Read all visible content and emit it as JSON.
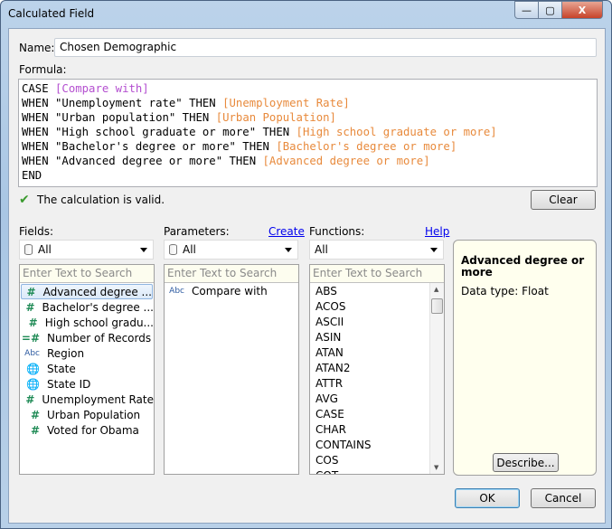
{
  "window": {
    "title": "Calculated Field",
    "minimize": "—",
    "maximize": "▢",
    "close": "X"
  },
  "name": {
    "label": "Name:",
    "value": "Chosen Demographic"
  },
  "formula": {
    "label": "Formula:",
    "lines": [
      [
        {
          "t": "CASE ",
          "c": "kw"
        },
        {
          "t": "[Compare with]",
          "c": "par"
        }
      ],
      [
        {
          "t": "WHEN \"Unemployment rate\" THEN ",
          "c": "kw"
        },
        {
          "t": "[Unemployment Rate]",
          "c": "fld"
        }
      ],
      [
        {
          "t": "WHEN \"Urban population\" THEN ",
          "c": "kw"
        },
        {
          "t": "[Urban Population]",
          "c": "fld"
        }
      ],
      [
        {
          "t": "WHEN \"High school graduate or more\" THEN ",
          "c": "kw"
        },
        {
          "t": "[High school graduate or more]",
          "c": "fld"
        }
      ],
      [
        {
          "t": "WHEN \"Bachelor's degree or more\" THEN ",
          "c": "kw"
        },
        {
          "t": "[Bachelor's degree or more]",
          "c": "fld"
        }
      ],
      [
        {
          "t": "WHEN \"Advanced degree or more\" THEN ",
          "c": "kw"
        },
        {
          "t": "[Advanced degree or more]",
          "c": "fld"
        }
      ],
      [
        {
          "t": "END",
          "c": "kw"
        }
      ]
    ]
  },
  "status": {
    "text": "The calculation is valid.",
    "icon": "check-icon"
  },
  "clear_label": "Clear",
  "fields": {
    "label": "Fields:",
    "filter": "All",
    "search_placeholder": "Enter Text to Search",
    "items": [
      {
        "icon": "#",
        "type": "num",
        "label": "Advanced degree ...",
        "selected": true
      },
      {
        "icon": "#",
        "type": "num",
        "label": "Bachelor's degree ..."
      },
      {
        "icon": "#",
        "type": "num",
        "label": "High school gradu..."
      },
      {
        "icon": "=#",
        "type": "num",
        "label": "Number of Records"
      },
      {
        "icon": "Abc",
        "type": "abc",
        "label": "Region"
      },
      {
        "icon": "🌐",
        "type": "glob",
        "label": "State"
      },
      {
        "icon": "🌐",
        "type": "glob",
        "label": "State ID"
      },
      {
        "icon": "#",
        "type": "num",
        "label": "Unemployment Rate"
      },
      {
        "icon": "#",
        "type": "num",
        "label": "Urban Population"
      },
      {
        "icon": "#",
        "type": "num",
        "label": "Voted for Obama"
      }
    ]
  },
  "parameters": {
    "label": "Parameters:",
    "create_link": "Create",
    "filter": "All",
    "search_placeholder": "Enter Text to Search",
    "items": [
      {
        "icon": "Abc",
        "type": "abc",
        "label": "Compare with"
      }
    ]
  },
  "functions": {
    "label": "Functions:",
    "help_link": "Help",
    "filter": "All",
    "search_placeholder": "Enter Text to Search",
    "items": [
      "ABS",
      "ACOS",
      "ASCII",
      "ASIN",
      "ATAN",
      "ATAN2",
      "ATTR",
      "AVG",
      "CASE",
      "CHAR",
      "CONTAINS",
      "COS",
      "COT"
    ]
  },
  "info": {
    "title": "Advanced degree or more",
    "datatype": "Data type: Float",
    "describe_label": "Describe..."
  },
  "ok_label": "OK",
  "cancel_label": "Cancel",
  "colors": {
    "field_ref": "#e88a3c",
    "param_ref": "#b44fd0",
    "measure_icon": "#1e8a55",
    "link": "#0000ee"
  }
}
